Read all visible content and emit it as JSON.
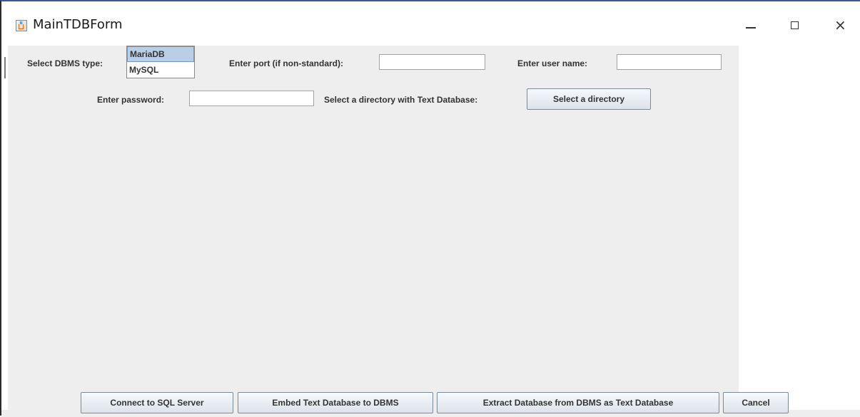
{
  "window": {
    "title": "MainTDBForm",
    "controls": {
      "minimize": "minimize",
      "maximize": "maximize",
      "close": "×"
    }
  },
  "form": {
    "dbms_type_label": "Select DBMS type:",
    "dbms_options": [
      "MariaDB",
      "MySQL"
    ],
    "dbms_selected": "MariaDB",
    "port_label": "Enter port (if non-standard):",
    "port_value": "",
    "user_label": "Enter user name:",
    "user_value": "",
    "password_label": "Enter password:",
    "password_value": "",
    "directory_label": "Select a directory with Text Database:",
    "directory_button": "Select a directory"
  },
  "actions": {
    "connect": "Connect to SQL Server",
    "embed": "Embed Text Database to DBMS",
    "extract": "Extract Database from DBMS as Text Database",
    "cancel": "Cancel"
  },
  "colors": {
    "panel_bg": "#eeeeee",
    "selection_bg": "#b8cfe5",
    "button_border": "#7a8a99"
  }
}
